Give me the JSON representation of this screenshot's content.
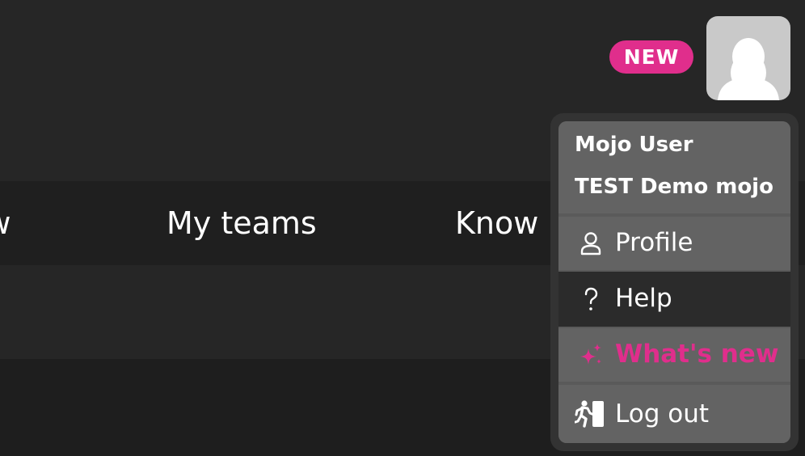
{
  "nav": {
    "items": [
      {
        "label": "ew"
      },
      {
        "label": "My teams"
      },
      {
        "label": "Know"
      }
    ]
  },
  "header": {
    "new_badge": "NEW",
    "avatar_icon": "user-avatar-icon"
  },
  "user_menu": {
    "user_name": "Mojo User",
    "org_name": "TEST Demo mojo",
    "items": [
      {
        "label": "Profile",
        "icon": "person-icon"
      },
      {
        "label": "Help",
        "icon": "question-icon"
      },
      {
        "label": "What's new",
        "icon": "sparkle-icon"
      },
      {
        "label": "Log out",
        "icon": "exit-icon"
      }
    ]
  },
  "colors": {
    "accent": "#e02e8c",
    "background": "#262626",
    "menu_background": "#636363",
    "menu_hover": "#2b2b2b"
  }
}
